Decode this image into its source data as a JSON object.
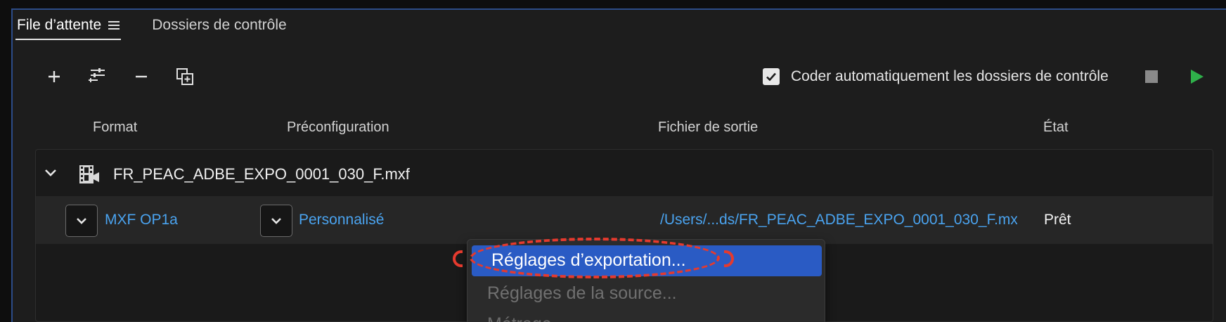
{
  "tabs": [
    {
      "label": "File d’attente"
    },
    {
      "label": "Dossiers de contrôle"
    }
  ],
  "toolbar": {
    "icons": [
      "add-icon",
      "preset-settings-icon",
      "remove-icon",
      "duplicate-icon"
    ],
    "auto_encode_checked": true,
    "auto_encode_label": "Coder automatiquement les dossiers de contrôle"
  },
  "columns": {
    "format": "Format",
    "preset": "Préconfiguration",
    "output": "Fichier de sortie",
    "status": "État"
  },
  "queue": {
    "source_file": "FR_PEAC_ADBE_EXPO_0001_030_F.mxf",
    "item": {
      "format": "MXF OP1a",
      "preset": "Personnalisé",
      "output": "/Users/...ds/FR_PEAC_ADBE_EXPO_0001_030_F.mxf",
      "status": "Prêt"
    }
  },
  "context_menu": {
    "items": [
      {
        "label": "Réglages d’exportation...",
        "state": "selected"
      },
      {
        "label": "Réglages de la source...",
        "state": "disabled"
      },
      {
        "label": "Métrage...",
        "state": "disabled"
      }
    ]
  },
  "colors": {
    "accent": "#2a5bc4",
    "link": "#4aa3ef",
    "play": "#2fb04a",
    "annotation": "#e53a2e"
  }
}
